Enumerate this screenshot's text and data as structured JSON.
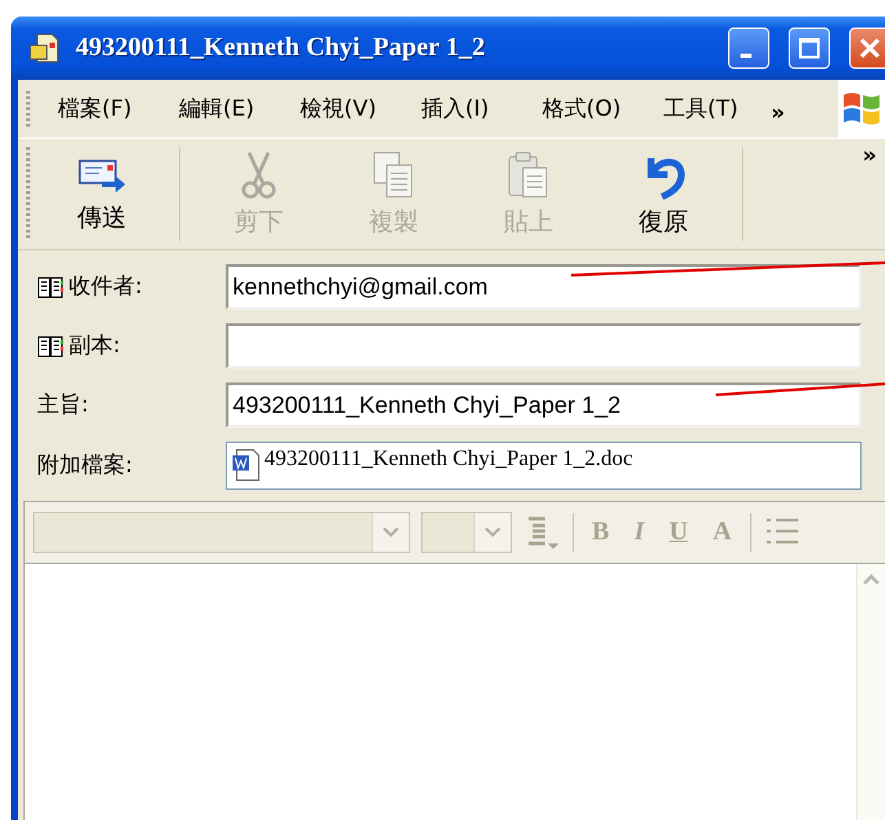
{
  "window": {
    "title": "493200111_Kenneth Chyi_Paper 1_2"
  },
  "menu": [
    {
      "label": "檔案(F)"
    },
    {
      "label": "編輯(E)"
    },
    {
      "label": "檢視(V)"
    },
    {
      "label": "插入(I)"
    },
    {
      "label": "格式(O)"
    },
    {
      "label": "工具(T)"
    }
  ],
  "menu_overflow": "»",
  "toolbar": [
    {
      "label": "傳送",
      "kind": "send",
      "disabled": false
    },
    {
      "label": "剪下",
      "kind": "cut",
      "disabled": true
    },
    {
      "label": "複製",
      "kind": "copy",
      "disabled": true
    },
    {
      "label": "貼上",
      "kind": "paste",
      "disabled": true
    },
    {
      "label": "復原",
      "kind": "undo",
      "disabled": false
    }
  ],
  "toolbar_overflow": "»",
  "fields": [
    {
      "label": "收件者:",
      "kind": "address",
      "value": "kennethchyi@gmail.com"
    },
    {
      "label": "副本:",
      "kind": "address"
    },
    {
      "label": "主旨:",
      "kind": "text",
      "value": "493200111_Kenneth Chyi_Paper 1_2"
    },
    {
      "label": "附加檔案:",
      "kind": "attachment",
      "value": "493200111_Kenneth Chyi_Paper 1_2.doc"
    }
  ],
  "format_toolbar": {
    "disabled": true,
    "buttons": [
      {
        "label": "B",
        "kind": "bold"
      },
      {
        "label": "I",
        "kind": "italic"
      },
      {
        "label": "U",
        "kind": "underline"
      },
      {
        "label": "A",
        "kind": "color"
      }
    ]
  }
}
